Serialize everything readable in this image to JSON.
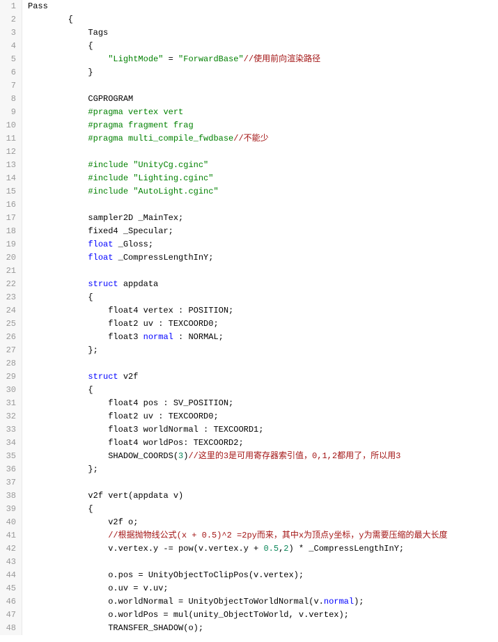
{
  "gutter": {
    "start": 1,
    "end": 48
  },
  "code": {
    "lines": [
      {
        "n": 1,
        "ind": 0,
        "parts": [
          {
            "t": "Pass",
            "c": "id"
          }
        ]
      },
      {
        "n": 2,
        "ind": 8,
        "parts": [
          {
            "t": "{",
            "c": "id"
          }
        ]
      },
      {
        "n": 3,
        "ind": 12,
        "parts": [
          {
            "t": "Tags",
            "c": "id"
          }
        ]
      },
      {
        "n": 4,
        "ind": 12,
        "parts": [
          {
            "t": "{",
            "c": "id"
          }
        ]
      },
      {
        "n": 5,
        "ind": 16,
        "parts": [
          {
            "t": "\"LightMode\"",
            "c": "dir"
          },
          {
            "t": " = ",
            "c": "id"
          },
          {
            "t": "\"ForwardBase\"",
            "c": "dir"
          },
          {
            "t": "//使用前向渲染路径",
            "c": "cmt"
          }
        ]
      },
      {
        "n": 6,
        "ind": 12,
        "parts": [
          {
            "t": "}",
            "c": "id"
          }
        ]
      },
      {
        "n": 7,
        "ind": 0,
        "parts": []
      },
      {
        "n": 8,
        "ind": 12,
        "parts": [
          {
            "t": "CGPROGRAM",
            "c": "id"
          }
        ]
      },
      {
        "n": 9,
        "ind": 12,
        "parts": [
          {
            "t": "#pragma vertex vert",
            "c": "dir"
          }
        ]
      },
      {
        "n": 10,
        "ind": 12,
        "parts": [
          {
            "t": "#pragma fragment frag",
            "c": "dir"
          }
        ]
      },
      {
        "n": 11,
        "ind": 12,
        "parts": [
          {
            "t": "#pragma multi_compile_fwdbase",
            "c": "dir"
          },
          {
            "t": "//不能少",
            "c": "cmt"
          }
        ]
      },
      {
        "n": 12,
        "ind": 0,
        "parts": []
      },
      {
        "n": 13,
        "ind": 12,
        "parts": [
          {
            "t": "#include ",
            "c": "dir"
          },
          {
            "t": "\"UnityCg.cginc\"",
            "c": "dir"
          }
        ]
      },
      {
        "n": 14,
        "ind": 12,
        "parts": [
          {
            "t": "#include ",
            "c": "dir"
          },
          {
            "t": "\"Lighting.cginc\"",
            "c": "dir"
          }
        ]
      },
      {
        "n": 15,
        "ind": 12,
        "parts": [
          {
            "t": "#include ",
            "c": "dir"
          },
          {
            "t": "\"AutoLight.cginc\"",
            "c": "dir"
          }
        ]
      },
      {
        "n": 16,
        "ind": 0,
        "parts": []
      },
      {
        "n": 17,
        "ind": 12,
        "parts": [
          {
            "t": "sampler2D _MainTex;",
            "c": "id"
          }
        ]
      },
      {
        "n": 18,
        "ind": 12,
        "parts": [
          {
            "t": "fixed4 _Specular;",
            "c": "id"
          }
        ]
      },
      {
        "n": 19,
        "ind": 12,
        "parts": [
          {
            "t": "float",
            "c": "type"
          },
          {
            "t": " _Gloss;",
            "c": "id"
          }
        ]
      },
      {
        "n": 20,
        "ind": 12,
        "parts": [
          {
            "t": "float",
            "c": "type"
          },
          {
            "t": " _CompressLengthInY;",
            "c": "id"
          }
        ]
      },
      {
        "n": 21,
        "ind": 0,
        "parts": []
      },
      {
        "n": 22,
        "ind": 12,
        "parts": [
          {
            "t": "struct",
            "c": "type"
          },
          {
            "t": " appdata",
            "c": "id"
          }
        ]
      },
      {
        "n": 23,
        "ind": 12,
        "parts": [
          {
            "t": "{",
            "c": "id"
          }
        ]
      },
      {
        "n": 24,
        "ind": 16,
        "parts": [
          {
            "t": "float4 vertex : POSITION;",
            "c": "id"
          }
        ]
      },
      {
        "n": 25,
        "ind": 16,
        "parts": [
          {
            "t": "float2 uv : TEXCOORD0;",
            "c": "id"
          }
        ]
      },
      {
        "n": 26,
        "ind": 16,
        "parts": [
          {
            "t": "float3 ",
            "c": "id"
          },
          {
            "t": "normal",
            "c": "type"
          },
          {
            "t": " : NORMAL;",
            "c": "id"
          }
        ]
      },
      {
        "n": 27,
        "ind": 12,
        "parts": [
          {
            "t": "};",
            "c": "id"
          }
        ]
      },
      {
        "n": 28,
        "ind": 0,
        "parts": []
      },
      {
        "n": 29,
        "ind": 12,
        "parts": [
          {
            "t": "struct",
            "c": "type"
          },
          {
            "t": " v2f",
            "c": "id"
          }
        ]
      },
      {
        "n": 30,
        "ind": 12,
        "parts": [
          {
            "t": "{",
            "c": "id"
          }
        ]
      },
      {
        "n": 31,
        "ind": 16,
        "parts": [
          {
            "t": "float4 pos : SV_POSITION;",
            "c": "id"
          }
        ]
      },
      {
        "n": 32,
        "ind": 16,
        "parts": [
          {
            "t": "float2 uv : TEXCOORD0;",
            "c": "id"
          }
        ]
      },
      {
        "n": 33,
        "ind": 16,
        "parts": [
          {
            "t": "float3 worldNormal : TEXCOORD1;",
            "c": "id"
          }
        ]
      },
      {
        "n": 34,
        "ind": 16,
        "parts": [
          {
            "t": "float4 worldPos: TEXCOORD2;",
            "c": "id"
          }
        ]
      },
      {
        "n": 35,
        "ind": 16,
        "parts": [
          {
            "t": "SHADOW_COORDS(",
            "c": "id"
          },
          {
            "t": "3",
            "c": "num"
          },
          {
            "t": ")",
            "c": "id"
          },
          {
            "t": "//这里的3是可用寄存器索引值，0,1,2都用了，所以用3",
            "c": "cmt"
          }
        ]
      },
      {
        "n": 36,
        "ind": 12,
        "parts": [
          {
            "t": "};",
            "c": "id"
          }
        ]
      },
      {
        "n": 37,
        "ind": 0,
        "parts": []
      },
      {
        "n": 38,
        "ind": 12,
        "parts": [
          {
            "t": "v2f vert(appdata v)",
            "c": "id"
          }
        ]
      },
      {
        "n": 39,
        "ind": 12,
        "parts": [
          {
            "t": "{",
            "c": "id"
          }
        ]
      },
      {
        "n": 40,
        "ind": 16,
        "parts": [
          {
            "t": "v2f o;",
            "c": "id"
          }
        ]
      },
      {
        "n": 41,
        "ind": 16,
        "parts": [
          {
            "t": "//根据抛物线公式(x + 0.5)^2 =2py而来，其中x为顶点y坐标，y为需要压缩的最大长度",
            "c": "cmt"
          }
        ]
      },
      {
        "n": 42,
        "ind": 16,
        "parts": [
          {
            "t": "v.vertex.y -= pow(v.vertex.y + ",
            "c": "id"
          },
          {
            "t": "0.5",
            "c": "num"
          },
          {
            "t": ",",
            "c": "id"
          },
          {
            "t": "2",
            "c": "num"
          },
          {
            "t": ") * _CompressLengthInY;",
            "c": "id"
          }
        ]
      },
      {
        "n": 43,
        "ind": 0,
        "parts": []
      },
      {
        "n": 44,
        "ind": 16,
        "parts": [
          {
            "t": "o.pos = UnityObjectToClipPos(v.vertex);",
            "c": "id"
          }
        ]
      },
      {
        "n": 45,
        "ind": 16,
        "parts": [
          {
            "t": "o.uv = v.uv;",
            "c": "id"
          }
        ]
      },
      {
        "n": 46,
        "ind": 16,
        "parts": [
          {
            "t": "o.worldNormal = UnityObjectToWorldNormal(v.",
            "c": "id"
          },
          {
            "t": "normal",
            "c": "type"
          },
          {
            "t": ");",
            "c": "id"
          }
        ]
      },
      {
        "n": 47,
        "ind": 16,
        "parts": [
          {
            "t": "o.worldPos = mul(unity_ObjectToWorld, v.vertex);",
            "c": "id"
          }
        ]
      },
      {
        "n": 48,
        "ind": 16,
        "parts": [
          {
            "t": "TRANSFER_SHADOW(o);",
            "c": "id"
          }
        ]
      }
    ]
  }
}
